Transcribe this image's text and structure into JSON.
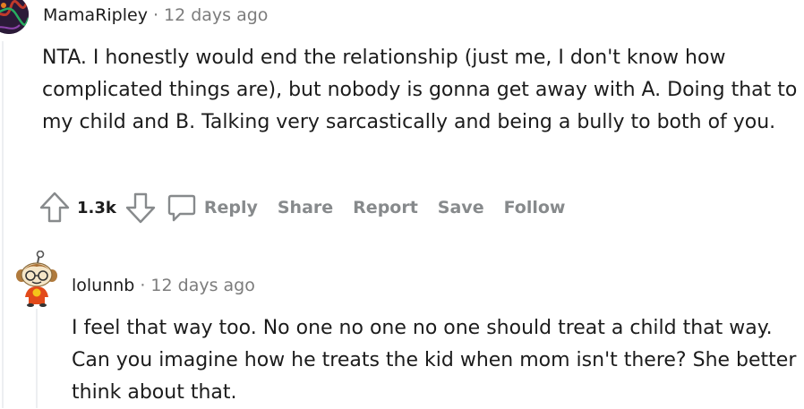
{
  "comments": [
    {
      "username": "MamaRipley",
      "separator": "·",
      "time": "12 days ago",
      "body": "NTA. I honestly would end the relationship (just me, I don't know how complicated things are), but nobody is gonna get away with A. Doing that to my child and B. Talking very sarcastically and being a bully to both of you.",
      "score": "1.3k",
      "actions": {
        "reply": "Reply",
        "share": "Share",
        "report": "Report",
        "save": "Save",
        "follow": "Follow"
      }
    },
    {
      "username": "lolunnb",
      "separator": "·",
      "time": "12 days ago",
      "body": "I feel that way too. No one no one no one should treat a child that way. Can you imagine how he treats the kid when mom isn't there? She better think about that."
    }
  ],
  "colors": {
    "text": "#1c1c1c",
    "meta": "#7c7c7c",
    "action": "#878a8c",
    "thread_line": "#edeff1"
  },
  "icons": [
    "upvote-icon",
    "downvote-icon",
    "comment-bubble-icon",
    "snoo-avatar-icon"
  ]
}
